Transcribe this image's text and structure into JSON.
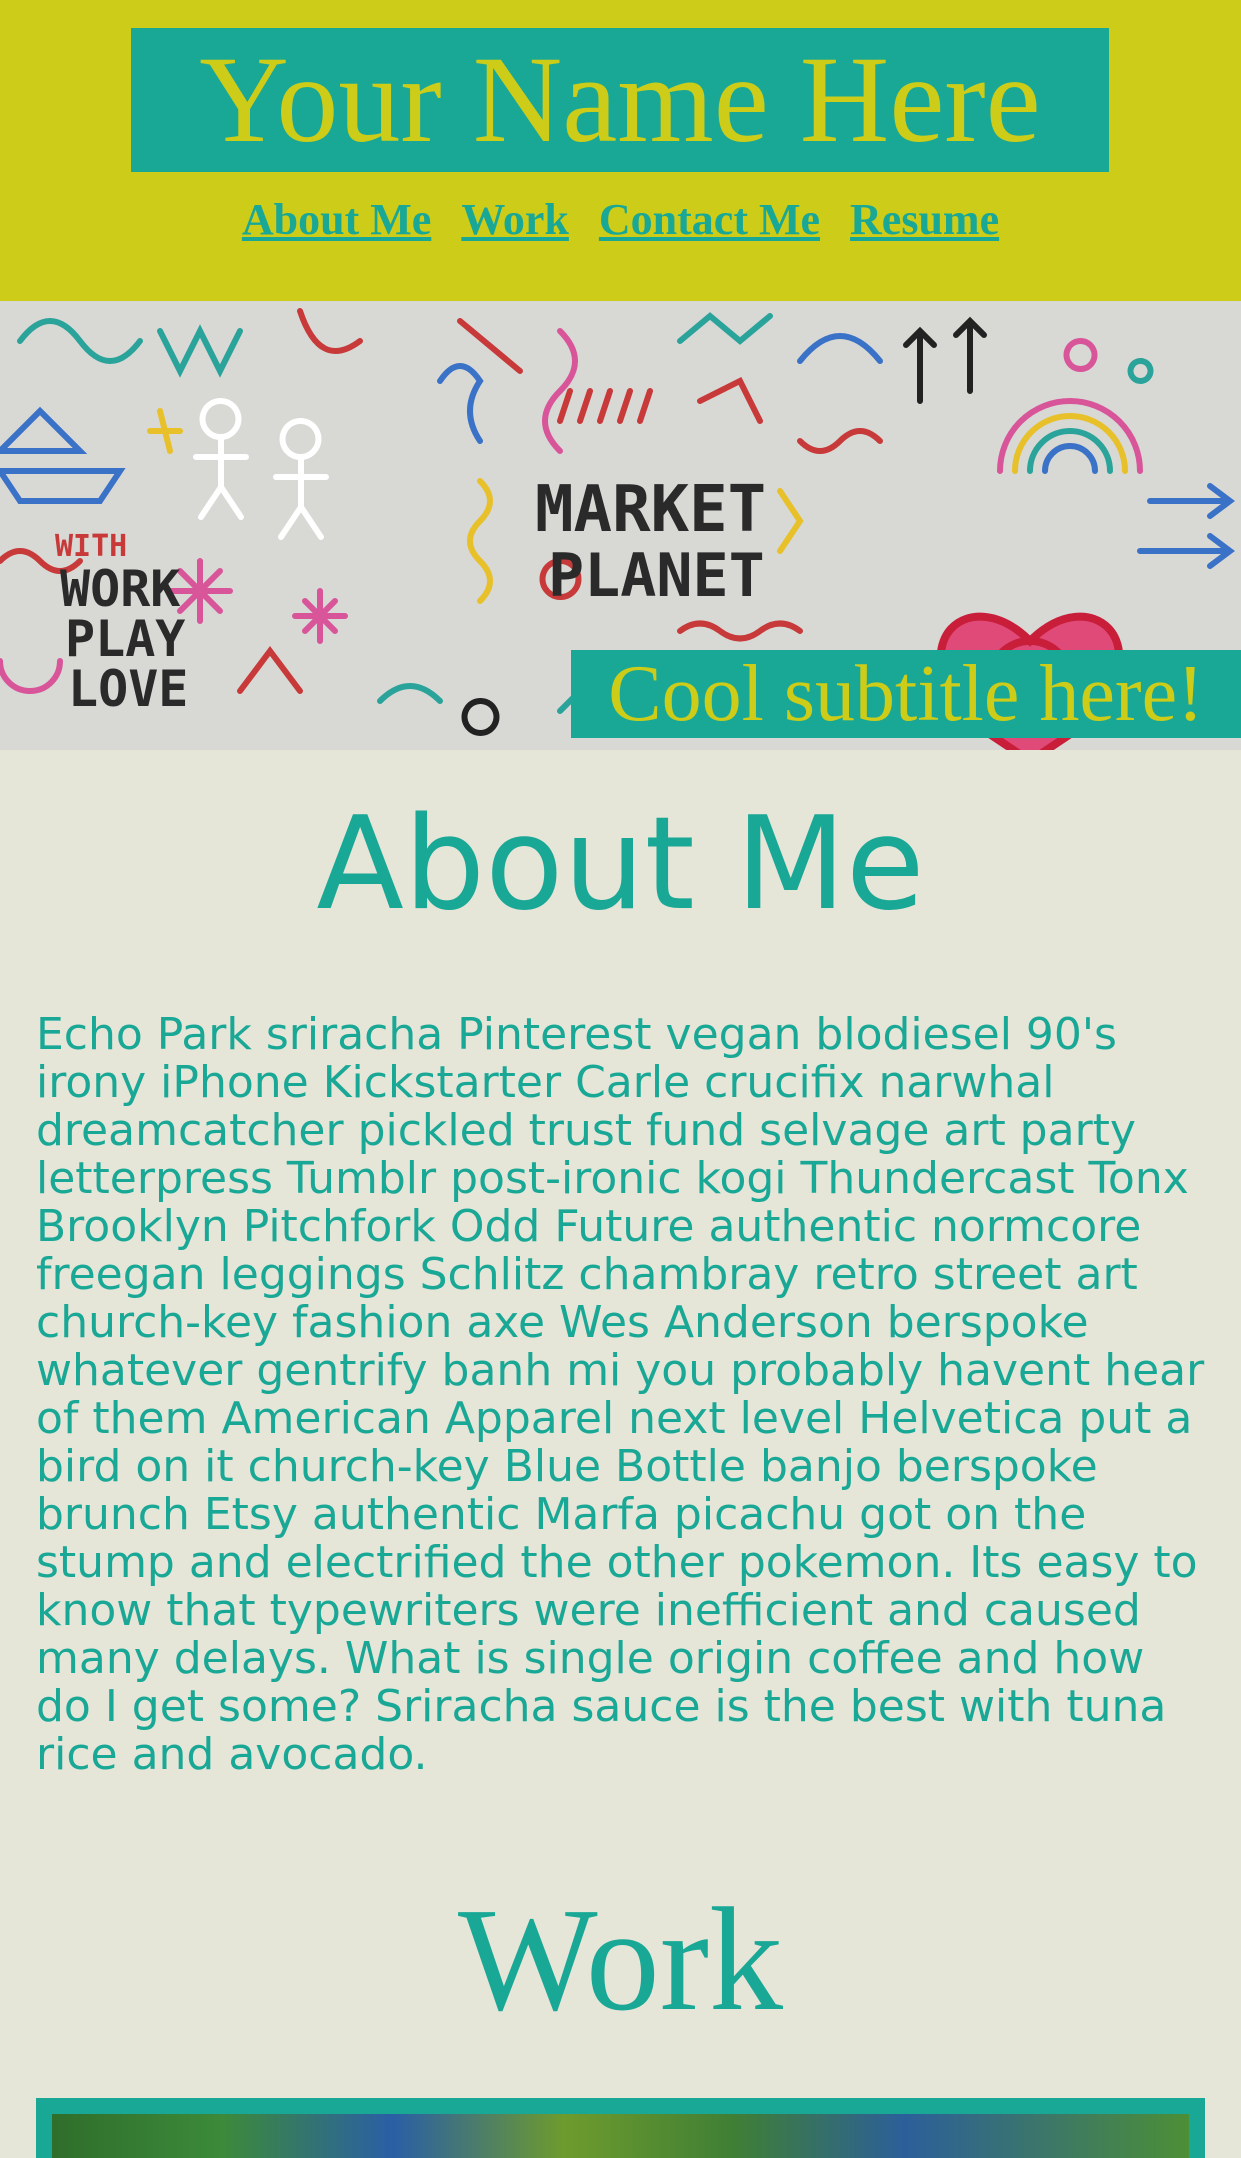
{
  "header": {
    "title": "Your Name Here",
    "nav": [
      {
        "label": "About Me"
      },
      {
        "label": "Work"
      },
      {
        "label": "Contact Me"
      },
      {
        "label": "Resume"
      }
    ]
  },
  "hero": {
    "subtitle": "Cool subtitle here!",
    "graffiti_text": [
      "MARKET",
      "PLANET",
      "WITH",
      "WORK",
      "PLAY",
      "LOVE"
    ]
  },
  "about": {
    "heading": "About Me",
    "body": "Echo Park sriracha Pinterest vegan blodiesel 90's irony iPhone Kickstarter Carle crucifix narwhal dreamcatcher pickled trust fund selvage art party letterpress Tumblr post-ironic kogi Thundercast Tonx Brooklyn Pitchfork Odd Future authentic normcore freegan leggings Schlitz chambray retro street art church-key fashion axe Wes Anderson berspoke whatever gentrify banh mi you probably havent hear of them American Apparel next level Helvetica put a bird on it church-key Blue Bottle banjo berspoke brunch Etsy authentic Marfa picachu got on the stump and electrified the other pokemon. Its easy to know that typewriters were inefficient and caused many delays. What is single origin coffee and how do I get some? Sriracha sauce is the best with tuna rice and avocado."
  },
  "work": {
    "heading": "Work"
  },
  "colors": {
    "header_bg": "#cccc19",
    "accent": "#1aa896",
    "page_bg": "#e5e5d8"
  }
}
